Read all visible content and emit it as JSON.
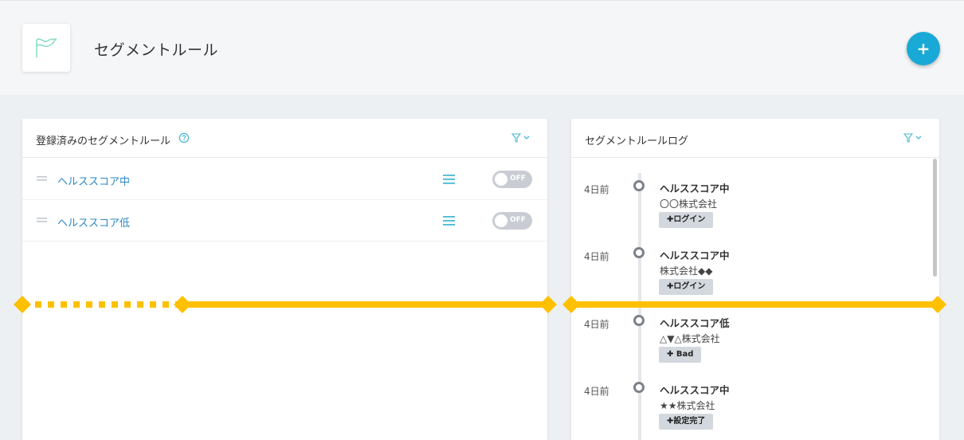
{
  "header": {
    "title": "セグメントルール",
    "logo_icon": "flag-icon",
    "add_button_label": "+"
  },
  "rules_panel": {
    "title": "登録済みのセグメントルール",
    "help_icon": "question-circle-icon",
    "filter_icon": "filter-icon",
    "rules": [
      {
        "name": "ヘルススコア中",
        "toggle_label": "OFF"
      },
      {
        "name": "ヘルススコア低",
        "toggle_label": "OFF"
      }
    ]
  },
  "log_panel": {
    "title": "セグメントルールログ",
    "filter_icon": "filter-icon",
    "entries": [
      {
        "time": "4日前",
        "rule": "ヘルススコア中",
        "company": "〇〇株式会社",
        "tag": "✚ログイン"
      },
      {
        "time": "4日前",
        "rule": "ヘルススコア中",
        "company": "株式会社◆◆",
        "tag": "✚ログイン"
      },
      {
        "time": "4日前",
        "rule": "ヘルススコア低",
        "company": "△▼△株式会社",
        "tag": "✚ Bad"
      },
      {
        "time": "4日前",
        "rule": "ヘルススコア中",
        "company": "★★株式会社",
        "tag": "✚設定完了"
      }
    ]
  },
  "colors": {
    "accent": "#19a9d6",
    "link": "#2a87c4",
    "icon_cyan": "#4bb8d3",
    "annotation": "#ffc000",
    "toggle_off": "#c9cdd3",
    "tag_bg": "#d3d8de"
  }
}
